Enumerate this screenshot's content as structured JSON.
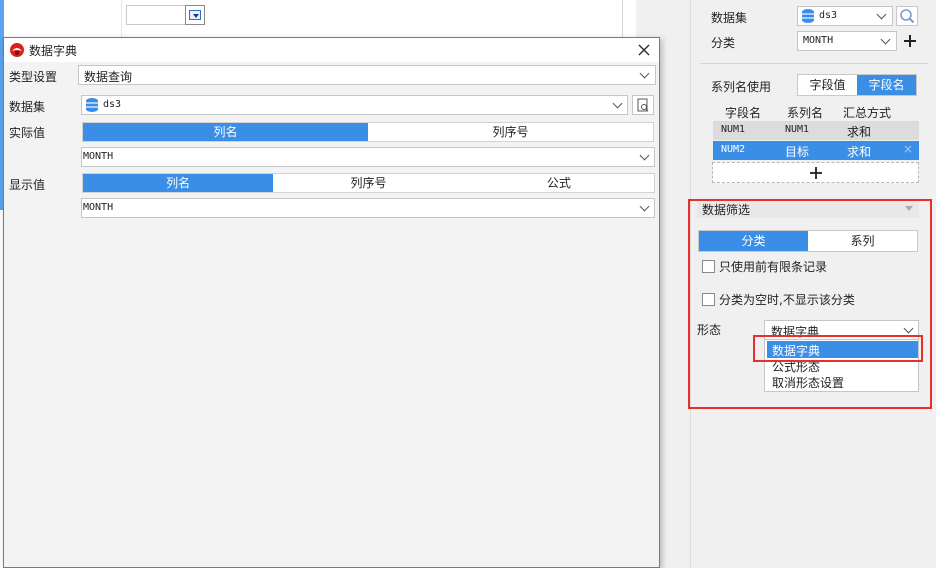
{
  "dialog": {
    "title": "数据字典",
    "type_label": "类型设置",
    "type_value": "数据查询",
    "dataset_label": "数据集",
    "dataset_value": "ds3",
    "actual_label": "实际值",
    "actual_tabs": [
      "列名",
      "列序号"
    ],
    "actual_value": "MONTH",
    "display_label": "显示值",
    "display_tabs": [
      "列名",
      "列序号",
      "公式"
    ],
    "display_value": "MONTH"
  },
  "right_panel": {
    "dataset_label": "数据集",
    "dataset_value": "ds3",
    "category_label": "分类",
    "category_value": "MONTH",
    "series_name_label": "系列名使用",
    "series_name_tabs": [
      "字段值",
      "字段名"
    ],
    "grid_headers": [
      "字段名",
      "系列名",
      "汇总方式"
    ],
    "grid_rows": [
      {
        "field": "NUM1",
        "series": "NUM1",
        "agg": "求和"
      },
      {
        "field": "NUM2",
        "series": "目标",
        "agg": "求和"
      }
    ],
    "add_symbol": "+",
    "filter_title": "数据筛选",
    "filter_tabs": [
      "分类",
      "系列"
    ],
    "check_limit_label": "只使用前有限条记录",
    "check_empty_label": "分类为空时,不显示该分类",
    "form_label": "形态",
    "form_value": "数据字典",
    "form_options": [
      "数据字典",
      "公式形态",
      "取消形态设置"
    ]
  },
  "colors": {
    "accent": "#3a8ee6",
    "highlight": "#e8302a"
  }
}
